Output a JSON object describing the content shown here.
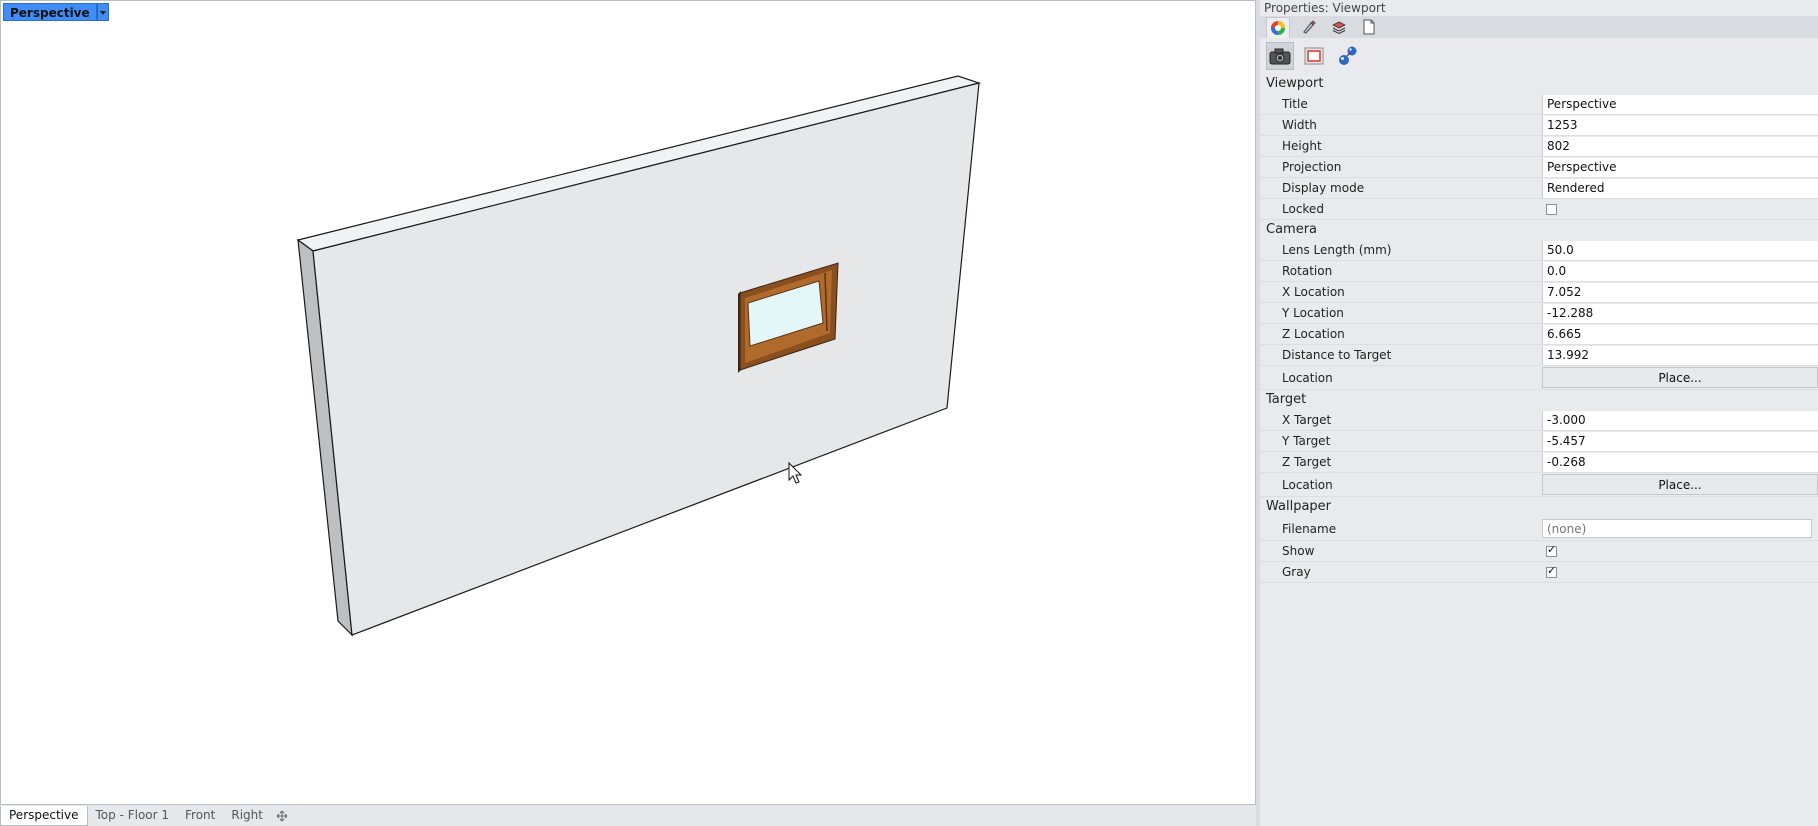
{
  "viewport": {
    "title": "Perspective",
    "tabs": [
      {
        "label": "Perspective",
        "active": true
      },
      {
        "label": "Top - Floor 1",
        "active": false
      },
      {
        "label": "Front",
        "active": false
      },
      {
        "label": "Right",
        "active": false
      }
    ],
    "add_tab_icon": "add-viewport-icon"
  },
  "properties": {
    "panel_title": "Properties: Viewport",
    "tab_icons": [
      "color-wheel-icon",
      "brush-icon",
      "layers-icon",
      "page-icon"
    ],
    "view_icons": [
      "camera-icon",
      "viewport-frame-icon",
      "render-sphere-icon"
    ],
    "sections": {
      "viewport": {
        "heading": "Viewport",
        "title_label": "Title",
        "title_value": "Perspective",
        "width_label": "Width",
        "width_value": "1253",
        "height_label": "Height",
        "height_value": "802",
        "projection_label": "Projection",
        "projection_value": "Perspective",
        "display_mode_label": "Display mode",
        "display_mode_value": "Rendered",
        "locked_label": "Locked",
        "locked": false
      },
      "camera": {
        "heading": "Camera",
        "lens_label": "Lens Length (mm)",
        "lens_value": "50.0",
        "rotation_label": "Rotation",
        "rotation_value": "0.0",
        "x_label": "X Location",
        "x_value": "7.052",
        "y_label": "Y Location",
        "y_value": "-12.288",
        "z_label": "Z Location",
        "z_value": "6.665",
        "dist_label": "Distance to Target",
        "dist_value": "13.992",
        "location_label": "Location",
        "place_label": "Place..."
      },
      "target": {
        "heading": "Target",
        "x_label": "X Target",
        "x_value": "-3.000",
        "y_label": "Y Target",
        "y_value": "-5.457",
        "z_label": "Z Target",
        "z_value": "-0.268",
        "location_label": "Location",
        "place_label": "Place..."
      },
      "wallpaper": {
        "heading": "Wallpaper",
        "filename_label": "Filename",
        "filename_placeholder": "(none)",
        "show_label": "Show",
        "show": true,
        "gray_label": "Gray",
        "gray": true
      }
    }
  },
  "colors": {
    "viewport_title_bg": "#3f8ef7",
    "window_frame": "#8a4f1e",
    "glass": "#e3f6f8",
    "wall_face": "#e6e7e9"
  }
}
